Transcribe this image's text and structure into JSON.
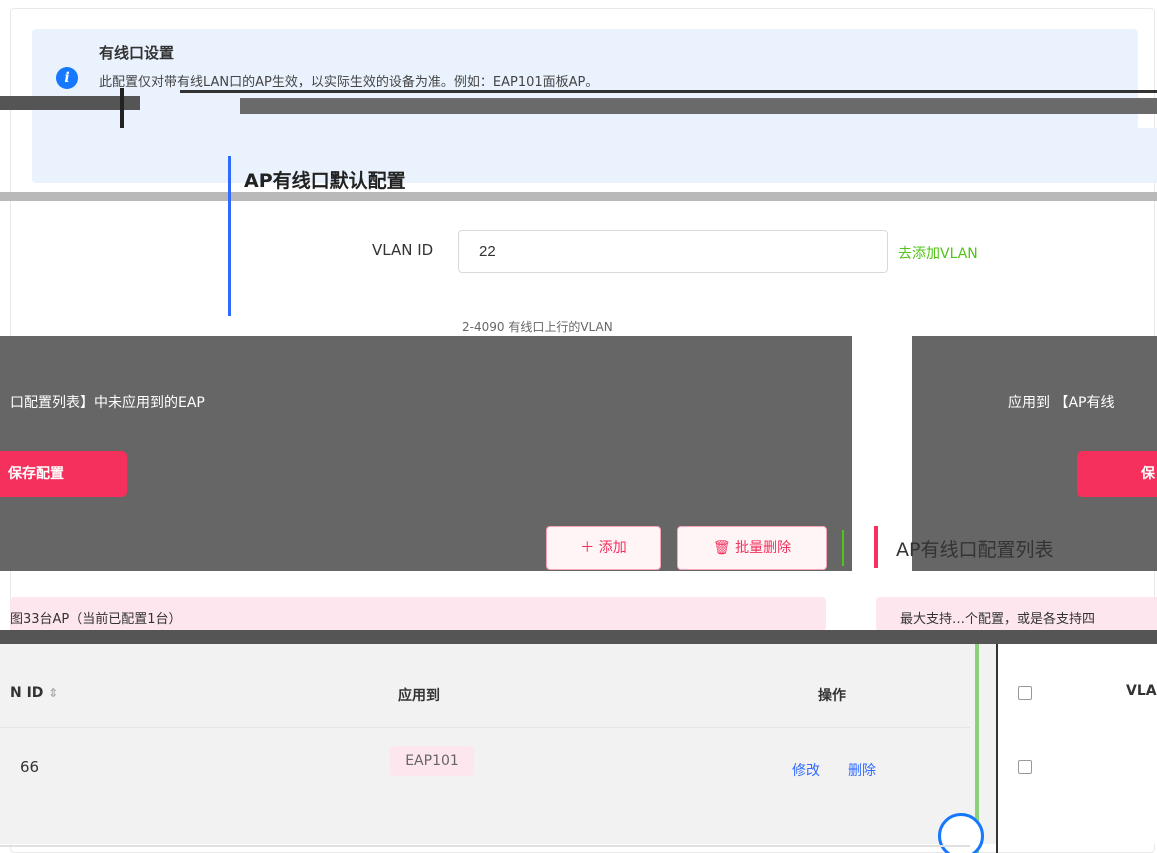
{
  "notice": {
    "title": "有线口设置",
    "text": "此配置仅对带有线LAN口的AP生效，以实际生效的设备为准。例如：EAP101面板AP。"
  },
  "section": {
    "title": "AP有线口默认配置"
  },
  "form": {
    "vlan_label": "VLAN ID",
    "vlan_value": "22",
    "add_vlan_link": "去添加VLAN",
    "hint": "2-4090 有线口上行的VLAN"
  },
  "apply": {
    "left_text": "口配置列表】中未应用到的EAP",
    "right_text": "应用到 【AP有线",
    "save_left": "保存配置",
    "save_right": "保"
  },
  "toolbar": {
    "add_label": "＋ 添加",
    "batch_delete_label": "批量删除"
  },
  "list": {
    "title": "AP有线口配置列表",
    "summary_left": "图33台AP（当前已配置1台）",
    "summary_right": "最大支持…个配置，或是各支持四"
  },
  "table": {
    "columns": [
      "N ID",
      "应用到",
      "操作"
    ],
    "rows": [
      {
        "vlan": "66",
        "applied_to": "EAP101",
        "edit": "修改",
        "delete": "删除"
      }
    ]
  },
  "right_table": {
    "column_vla": "VLA"
  }
}
